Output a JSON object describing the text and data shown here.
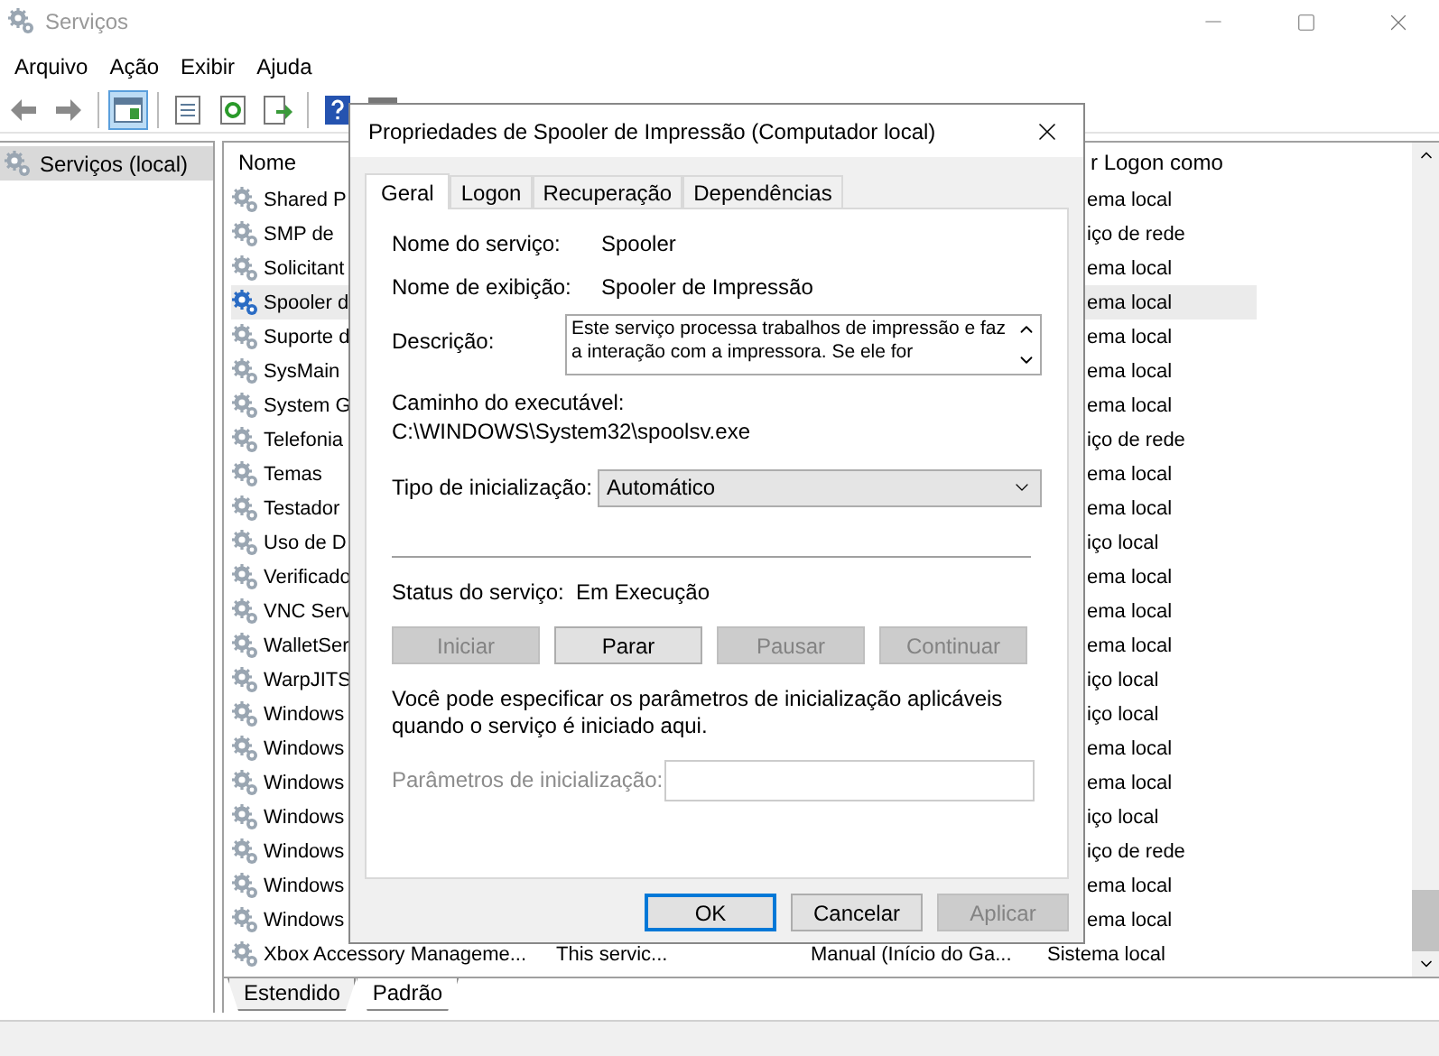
{
  "window": {
    "title": "Serviços"
  },
  "menu": [
    "Arquivo",
    "Ação",
    "Exibir",
    "Ajuda"
  ],
  "toolbar": [
    {
      "kind": "back",
      "pressed": false
    },
    {
      "kind": "forward",
      "pressed": false
    },
    {
      "kind": "separator"
    },
    {
      "kind": "tree",
      "pressed": true
    },
    {
      "kind": "separator"
    },
    {
      "kind": "properties",
      "pressed": false
    },
    {
      "kind": "refresh",
      "pressed": false
    },
    {
      "kind": "export",
      "pressed": false
    },
    {
      "kind": "separator"
    },
    {
      "kind": "help",
      "pressed": false
    },
    {
      "kind": "console",
      "pressed": false
    }
  ],
  "tree": {
    "items": [
      {
        "label": "Serviços (local)",
        "selected": true
      }
    ]
  },
  "list": {
    "columns": [
      {
        "label": "Nome"
      },
      {
        "label": "r Logon como"
      }
    ],
    "rows": [
      {
        "name": "Shared P",
        "logon": "ema local",
        "selected": false
      },
      {
        "name": "SMP de",
        "logon": "iço de rede",
        "selected": false
      },
      {
        "name": "Solicitant",
        "logon": "ema local",
        "selected": false
      },
      {
        "name": "Spooler d",
        "logon": "ema local",
        "selected": true
      },
      {
        "name": "Suporte d",
        "logon": "ema local",
        "selected": false
      },
      {
        "name": "SysMain",
        "logon": "ema local",
        "selected": false
      },
      {
        "name": "System G",
        "logon": "ema local",
        "selected": false
      },
      {
        "name": "Telefonia",
        "logon": "iço de rede",
        "selected": false
      },
      {
        "name": "Temas",
        "logon": "ema local",
        "selected": false
      },
      {
        "name": "Testador",
        "logon": "ema local",
        "selected": false
      },
      {
        "name": "Uso de D",
        "logon": "iço local",
        "selected": false
      },
      {
        "name": "Verificado",
        "logon": "ema local",
        "selected": false
      },
      {
        "name": "VNC Serv",
        "logon": "ema local",
        "selected": false
      },
      {
        "name": "WalletSer",
        "logon": "ema local",
        "selected": false
      },
      {
        "name": "WarpJITS",
        "logon": "iço local",
        "selected": false
      },
      {
        "name": "Windows",
        "logon": "iço local",
        "selected": false
      },
      {
        "name": "Windows",
        "logon": "ema local",
        "selected": false
      },
      {
        "name": "Windows",
        "logon": "ema local",
        "selected": false
      },
      {
        "name": "Windows",
        "logon": "iço local",
        "selected": false
      },
      {
        "name": "Windows",
        "logon": "iço de rede",
        "selected": false
      },
      {
        "name": "Windows",
        "logon": "ema local",
        "selected": false
      },
      {
        "name": "Windows",
        "logon": "ema local",
        "selected": false
      },
      {
        "name": "Xbox Accessory Manageme...",
        "description": "This servic...",
        "startup": "Manual (Início do Ga...",
        "logon": "Sistema local",
        "selected": false
      }
    ],
    "view_tabs": [
      {
        "label": "Estendido",
        "selected": false
      },
      {
        "label": "Padrão",
        "selected": true
      }
    ]
  },
  "dialog": {
    "title": "Propriedades de Spooler de Impressão (Computador local)",
    "tabs": [
      {
        "label": "Geral",
        "selected": true
      },
      {
        "label": "Logon",
        "selected": false
      },
      {
        "label": "Recuperação",
        "selected": false
      },
      {
        "label": "Dependências",
        "selected": false
      }
    ],
    "fields": [
      {
        "label": "Nome do serviço:",
        "value": "Spooler"
      },
      {
        "label": "Nome de exibição:",
        "value": "Spooler de Impressão"
      }
    ],
    "description": {
      "label": "Descrição:",
      "lines": [
        "Este serviço processa trabalhos de impressão e faz",
        "a interação com a impressora. Se ele for"
      ]
    },
    "path": {
      "label": "Caminho do executável:",
      "value": "C:\\WINDOWS\\System32\\spoolsv.exe"
    },
    "startup": {
      "label": "Tipo de inicialização:",
      "value": "Automático"
    },
    "status": {
      "label": "Status do serviço:",
      "value": "Em Execução"
    },
    "service_buttons": [
      {
        "label": "Iniciar",
        "disabled": true
      },
      {
        "label": "Parar",
        "disabled": false
      },
      {
        "label": "Pausar",
        "disabled": true
      },
      {
        "label": "Continuar",
        "disabled": true
      }
    ],
    "note": "Você pode especificar os parâmetros de inicialização aplicáveis quando o serviço é iniciado aqui.",
    "params": {
      "label": "Parâmetros de inicialização:",
      "disabled": true
    },
    "buttons": [
      {
        "label": "OK",
        "default": true,
        "disabled": false
      },
      {
        "label": "Cancelar",
        "default": false,
        "disabled": false
      },
      {
        "label": "Aplicar",
        "default": false,
        "disabled": true
      }
    ]
  }
}
